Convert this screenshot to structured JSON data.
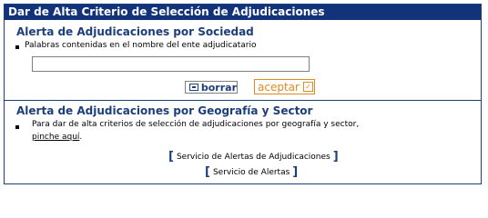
{
  "window": {
    "title": "Dar de Alta Criterio de Selección de Adjudicaciones"
  },
  "sociedad": {
    "heading": "Alerta de Adjudicaciones por Sociedad",
    "field_label": "Palabras contenidas en el nombre del ente adjudicatario",
    "field_value": "",
    "borrar_label": "borrar",
    "aceptar_label": "aceptar"
  },
  "geografia": {
    "heading": "Alerta de Adjudicaciones por Geografía y Sector",
    "description": "Para dar de alta criterios de selección de adjudicaciones por geografía y sector,",
    "link_text": "pinche aquí",
    "link_suffix": "."
  },
  "links": [
    {
      "label": "Servicio de Alertas de Adjudicaciones"
    },
    {
      "label": "Servicio de Alertas"
    }
  ],
  "colors": {
    "title_bg": "#12337a",
    "heading": "#1b3f7a",
    "accept": "#e08a22"
  }
}
